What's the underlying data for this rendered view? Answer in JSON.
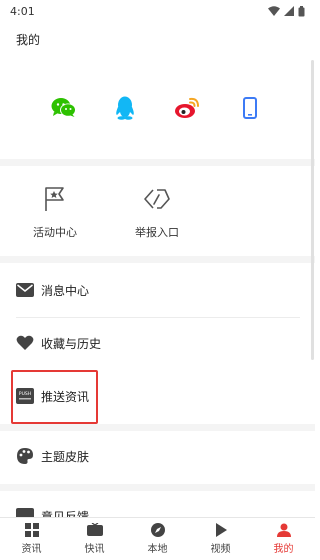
{
  "status": {
    "time": "4:01"
  },
  "page_title": "我的",
  "login_options": [
    {
      "name": "wechat",
      "color": "#2dc100"
    },
    {
      "name": "qq",
      "color": "#12b7f5"
    },
    {
      "name": "weibo",
      "color": "#e6162d"
    },
    {
      "name": "phone",
      "color": "#3d7bf5"
    }
  ],
  "quick_actions": [
    {
      "label": "活动中心"
    },
    {
      "label": "举报入口"
    }
  ],
  "menu": {
    "messages": "消息中心",
    "favorites": "收藏与历史",
    "push": "推送资讯",
    "theme": "主题皮肤",
    "feedback": "意见反馈"
  },
  "push_icon_text": "PUSH",
  "tabs": [
    {
      "label": "资讯"
    },
    {
      "label": "快讯"
    },
    {
      "label": "本地"
    },
    {
      "label": "视频"
    },
    {
      "label": "我的",
      "active": true
    }
  ],
  "accent_color": "#e53935"
}
